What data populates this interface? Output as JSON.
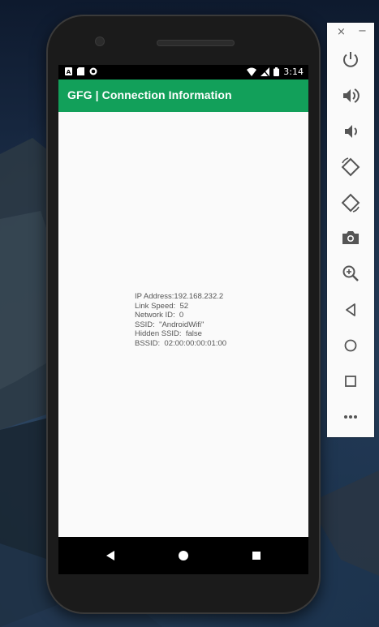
{
  "status_bar": {
    "time": "3:14"
  },
  "app_bar": {
    "title": "GFG | Connection Information"
  },
  "connection_info": {
    "ip_address": "IP Address:192.168.232.2",
    "link_speed": "Link Speed:  52",
    "network_id": "Network ID:  0",
    "ssid": "SSID:  \"AndroidWifi\"",
    "hidden_ssid": "Hidden SSID:  false",
    "bssid": "BSSID:  02:00:00:00:01:00"
  },
  "toolbar": {
    "close_label": "×",
    "minimize_label": "−",
    "buttons": [
      "power-icon",
      "volume-up-icon",
      "volume-down-icon",
      "rotate-left-icon",
      "rotate-right-icon",
      "camera-icon",
      "zoom-icon",
      "back-icon",
      "home-icon",
      "overview-icon",
      "more-icon"
    ]
  },
  "colors": {
    "app_bar": "#12a05a",
    "content_background": "#fafafa",
    "text": "#555555"
  }
}
